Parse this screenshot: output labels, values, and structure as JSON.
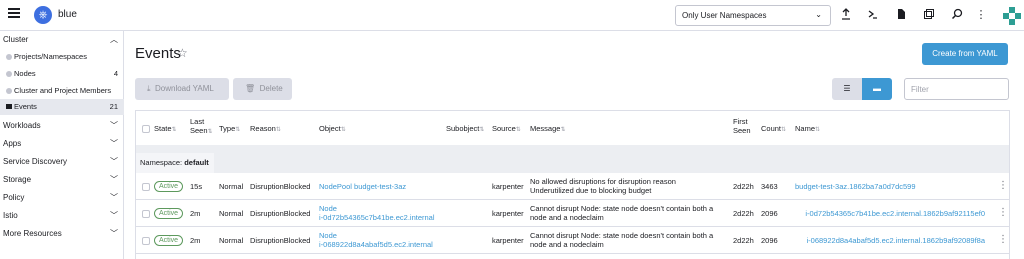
{
  "topbar": {
    "cluster_name": "blue",
    "namespace_filter": "Only User Namespaces",
    "icons": [
      "menu-icon",
      "kubernetes-logo-icon",
      "upload-icon",
      "terminal-icon",
      "file-icon",
      "copy-icon",
      "search-icon",
      "more-icon",
      "user-avatar"
    ]
  },
  "sidebar": {
    "cluster_label": "Cluster",
    "items": [
      {
        "label": "Projects/Namespaces",
        "count": ""
      },
      {
        "label": "Nodes",
        "count": "4"
      },
      {
        "label": "Cluster and Project Members",
        "count": ""
      },
      {
        "label": "Events",
        "count": "21"
      }
    ],
    "groups": [
      "Workloads",
      "Apps",
      "Service Discovery",
      "Storage",
      "Policy",
      "Istio",
      "More Resources"
    ]
  },
  "page": {
    "title": "Events",
    "create_button": "Create from YAML",
    "download_button": "Download YAML",
    "delete_button": "Delete",
    "filter_placeholder": "Filter"
  },
  "table": {
    "headers": {
      "state": "State",
      "last_seen": "Last Seen",
      "type": "Type",
      "reason": "Reason",
      "object": "Object",
      "subobject": "Subobject",
      "source": "Source",
      "message": "Message",
      "first_seen": "First Seen",
      "count": "Count",
      "name": "Name"
    },
    "group_label": "Namespace:",
    "group_value": "default",
    "rows": [
      {
        "state": "Active",
        "last_seen": "15s",
        "type": "Normal",
        "reason": "DisruptionBlocked",
        "object_line1": "NodePool budget-test-3az",
        "object_line2": "",
        "source": "karpenter",
        "message_line1": "No allowed disruptions for disruption reason",
        "message_line2": "Underutilized due to blocking budget",
        "first_seen": "2d22h",
        "count": "3463",
        "name": "budget-test-3az.1862ba7a0d7dc599"
      },
      {
        "state": "Active",
        "last_seen": "2m",
        "type": "Normal",
        "reason": "DisruptionBlocked",
        "object_line1": "Node",
        "object_line2": "i-0d72b54365c7b41be.ec2.internal",
        "source": "karpenter",
        "message_line1": "Cannot disrupt Node: state node doesn't contain both a",
        "message_line2": "node and a nodeclaim",
        "first_seen": "2d22h",
        "count": "2096",
        "name": "i-0d72b54365c7b41be.ec2.internal.1862b9af92115ef0"
      },
      {
        "state": "Active",
        "last_seen": "2m",
        "type": "Normal",
        "reason": "DisruptionBlocked",
        "object_line1": "Node",
        "object_line2": "i-068922d8a4abaf5d5.ec2.internal",
        "source": "karpenter",
        "message_line1": "Cannot disrupt Node: state node doesn't contain both a",
        "message_line2": "node and a nodeclaim",
        "first_seen": "2d22h",
        "count": "2096",
        "name": "i-068922d8a4abaf5d5.ec2.internal.1862b9af92089f8a"
      }
    ]
  },
  "colors": {
    "accent": "#3d98d3",
    "active_badge": "#5d995d",
    "border": "#dcdee7"
  }
}
